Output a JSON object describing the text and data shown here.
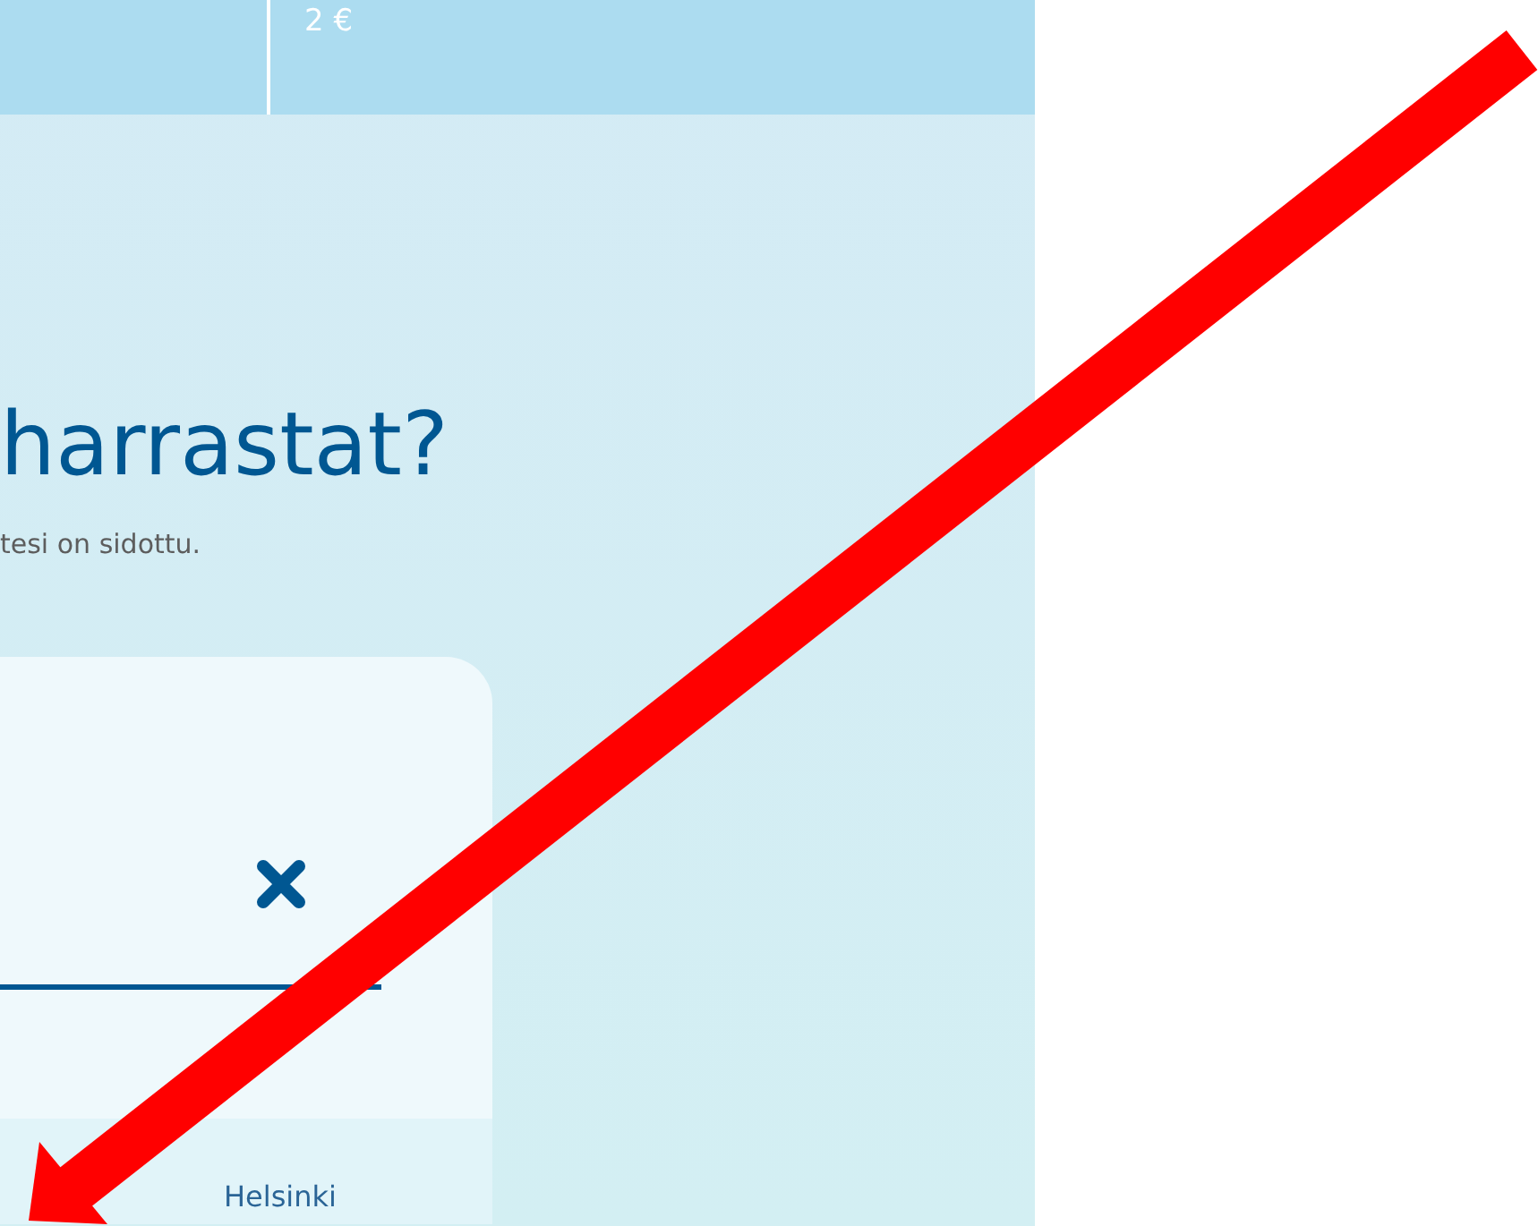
{
  "price_bar": {
    "price": "2 €"
  },
  "heading": "harrastat?",
  "subtitle": "tesi on sidottu.",
  "search_card": {
    "result": "Helsinki"
  }
}
